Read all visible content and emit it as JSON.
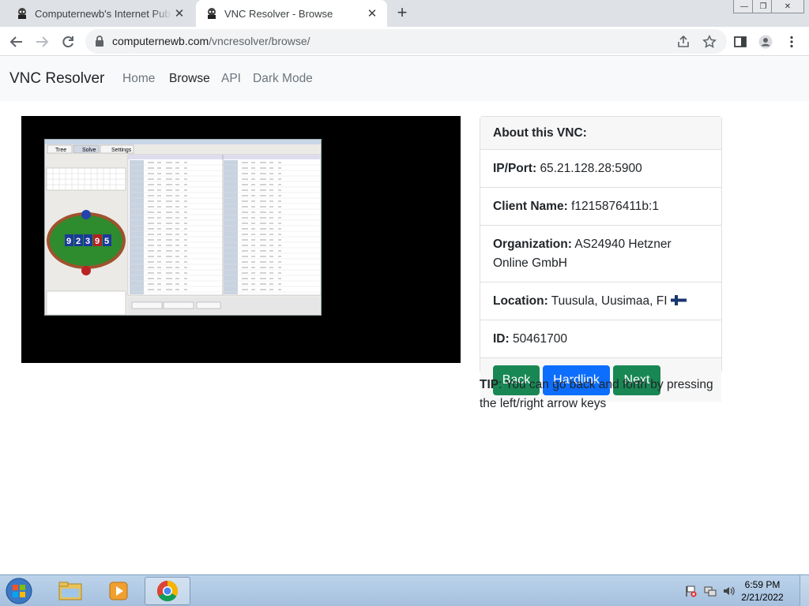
{
  "browser": {
    "tabs": [
      {
        "title": "Computernewb's Internet Pub Hu",
        "active": false
      },
      {
        "title": "VNC Resolver - Browse",
        "active": true
      }
    ],
    "url_host": "computernewb.com",
    "url_path": "/vncresolver/browse/"
  },
  "site": {
    "brand": "VNC Resolver",
    "nav": [
      "Home",
      "Browse",
      "API",
      "Dark Mode"
    ],
    "active_nav": "Browse"
  },
  "card": {
    "header": "About this VNC:",
    "ip_label": "IP/Port:",
    "ip_value": "65.21.128.28:5900",
    "client_label": "Client Name:",
    "client_value": "f1215876411b:1",
    "org_label": "Organization:",
    "org_value": "AS24940 Hetzner Online GmbH",
    "location_label": "Location:",
    "location_value": "Tuusula, Uusimaa, FI",
    "id_label": "ID:",
    "id_value": "50461700",
    "buttons": {
      "back": "Back",
      "hardlink": "Hardlink",
      "next": "Next"
    }
  },
  "tip": {
    "label": "TIP",
    "text": ": You can go back and forth by pressing the left/right arrow keys"
  },
  "vnc_screenshot": {
    "tabs": [
      "Tree",
      "Solve",
      "Settings"
    ],
    "cards": [
      "9",
      "2",
      "3",
      "9",
      "5"
    ]
  },
  "taskbar": {
    "time": "6:59 PM",
    "date": "2/21/2022"
  },
  "colors": {
    "green": "#198754",
    "blue": "#0d6efd",
    "felt": "#2e8b2e"
  }
}
